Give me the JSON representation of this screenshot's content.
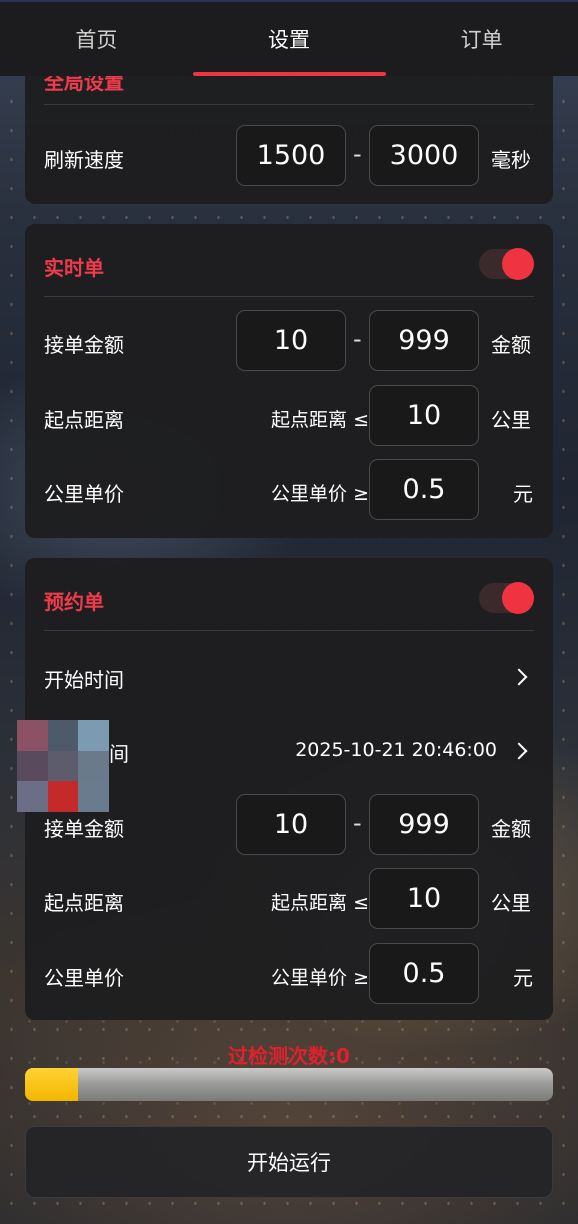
{
  "nav": {
    "tabs": [
      {
        "label": "首页",
        "active": false
      },
      {
        "label": "设置",
        "active": true
      },
      {
        "label": "订单",
        "active": false
      }
    ]
  },
  "global": {
    "title": "全局设置",
    "refresh": {
      "label": "刷新速度",
      "min": "1500",
      "max": "3000",
      "dash": "-",
      "unit": "毫秒"
    }
  },
  "realtime": {
    "title": "实时单",
    "enabled": true,
    "amount": {
      "label": "接单金额",
      "min": "10",
      "max": "999",
      "dash": "-",
      "unit": "金额"
    },
    "distance": {
      "label": "起点距离",
      "prefix": "起点距离 ≤",
      "value": "10",
      "unit": "公里"
    },
    "price": {
      "label": "公里单价",
      "prefix": "公里单价 ≥",
      "value": "0.5",
      "unit": "元"
    }
  },
  "reserve": {
    "title": "预约单",
    "enabled": true,
    "start_time": {
      "label": "开始时间",
      "value": ""
    },
    "end_time": {
      "label": "间",
      "value": "2025-10-21 20:46:00"
    },
    "amount": {
      "label": "接单金额",
      "min": "10",
      "max": "999",
      "dash": "-",
      "unit": "金额"
    },
    "distance": {
      "label": "起点距离",
      "prefix": "起点距离 ≤",
      "value": "10",
      "unit": "公里"
    },
    "price": {
      "label": "公里单价",
      "prefix": "公里单价 ≥",
      "value": "0.5",
      "unit": "元"
    }
  },
  "status": {
    "counter_text": "过检测次数:0",
    "progress_fraction": 0.1
  },
  "actions": {
    "run_label": "开始运行"
  },
  "colors": {
    "accent": "#ef3340",
    "progress_fill": "#ffd233"
  },
  "mosaic_colors": [
    "#8a5264",
    "#4d5a6a",
    "#7c9ab0",
    "#5a4a5e",
    "#5c5c6c",
    "#6a7a8a",
    "#6c6d86",
    "#c42a2a",
    "#6b7b8e"
  ]
}
